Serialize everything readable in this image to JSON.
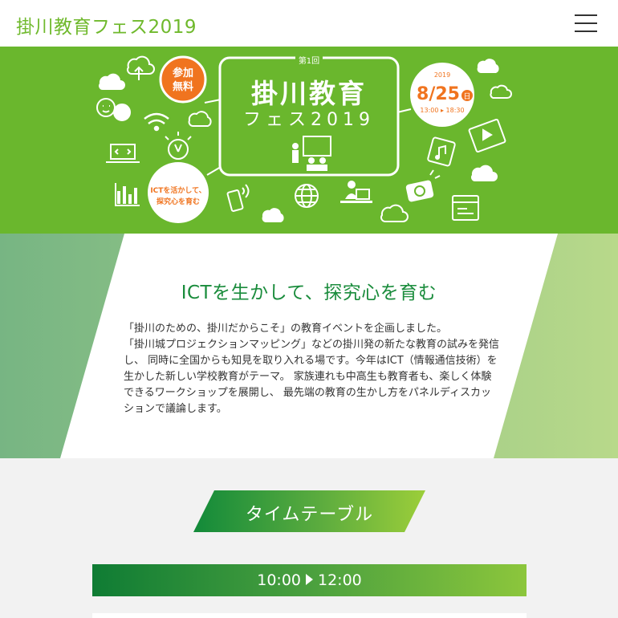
{
  "header": {
    "title": "掛川教育フェス2019",
    "menu_icon": "hamburger-icon"
  },
  "hero": {
    "badge_free_line1": "参加",
    "badge_free_line2": "無料",
    "edition": "第1回",
    "event_name_line1": "掛川教育",
    "event_name_line2": "フェス2019",
    "year": "2019",
    "date": "8/25",
    "weekday": "日",
    "time": "13:00 ▸ 18:30",
    "tagline_line1": "ICTを活かして、",
    "tagline_line2": "探究心を育む",
    "colors": {
      "background": "#6ab72d",
      "accent_orange": "#f0741f"
    }
  },
  "intro": {
    "title": "ICTを生かして、探究心を育む",
    "body": "「掛川のための、掛川だからこそ」の教育イベントを企画しました。\n「掛川城プロジェクションマッピング」などの掛川発の新たな教育の試みを発信し、 同時に全国からも知見を取り入れる場です。今年はICT（情報通信技術）を生かした新しい学校教育がテーマ。 家族連れも中高生も教育者も、楽しく体験できるワークショップを展開し、 最先端の教育の生かし方をパネルディスカッションで議論します。"
  },
  "timetable": {
    "heading": "タイムテーブル",
    "slots": [
      {
        "start": "10:00",
        "end": "12:00"
      }
    ]
  }
}
